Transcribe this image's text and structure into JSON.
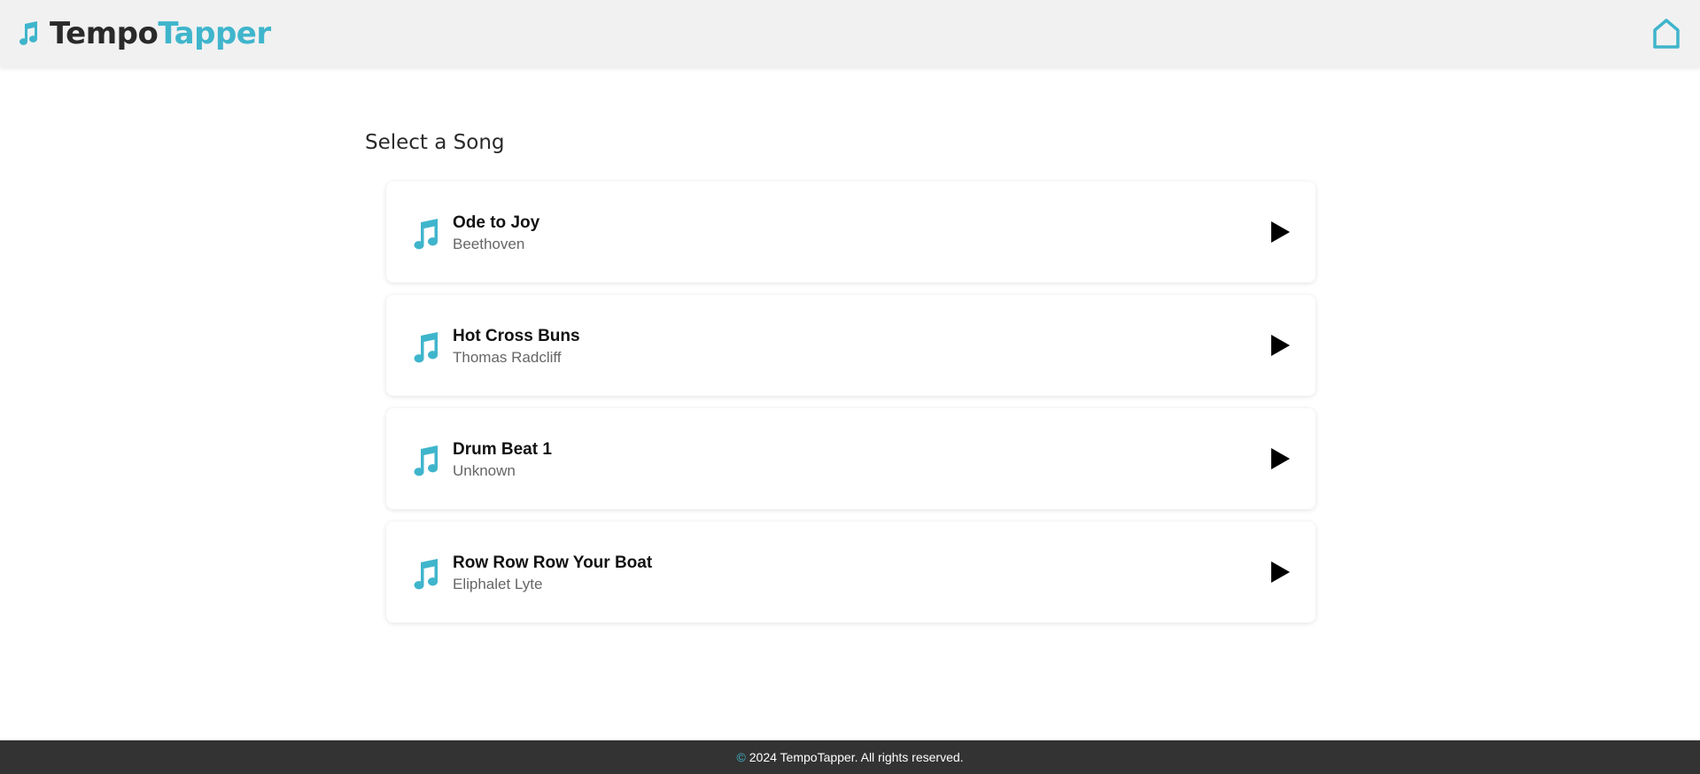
{
  "header": {
    "brand_part1": "Tempo",
    "brand_part2": "Tapper",
    "logo_icon": "music-note-icon",
    "home_icon": "home-icon"
  },
  "main": {
    "title": "Select a Song",
    "songs": [
      {
        "title": "Ode to Joy",
        "artist": "Beethoven"
      },
      {
        "title": "Hot Cross Buns",
        "artist": "Thomas Radcliff"
      },
      {
        "title": "Drum Beat 1",
        "artist": "Unknown"
      },
      {
        "title": "Row Row Row Your Boat",
        "artist": "Eliphalet Lyte"
      }
    ],
    "song_icon": "music-note-icon",
    "play_icon": "play-icon"
  },
  "footer": {
    "copyright_symbol": "©",
    "text": "2024 TempoTapper. All rights reserved."
  },
  "colors": {
    "accent": "#3fb5cc",
    "header_bg": "#f1f1f1",
    "footer_bg": "#333333"
  }
}
